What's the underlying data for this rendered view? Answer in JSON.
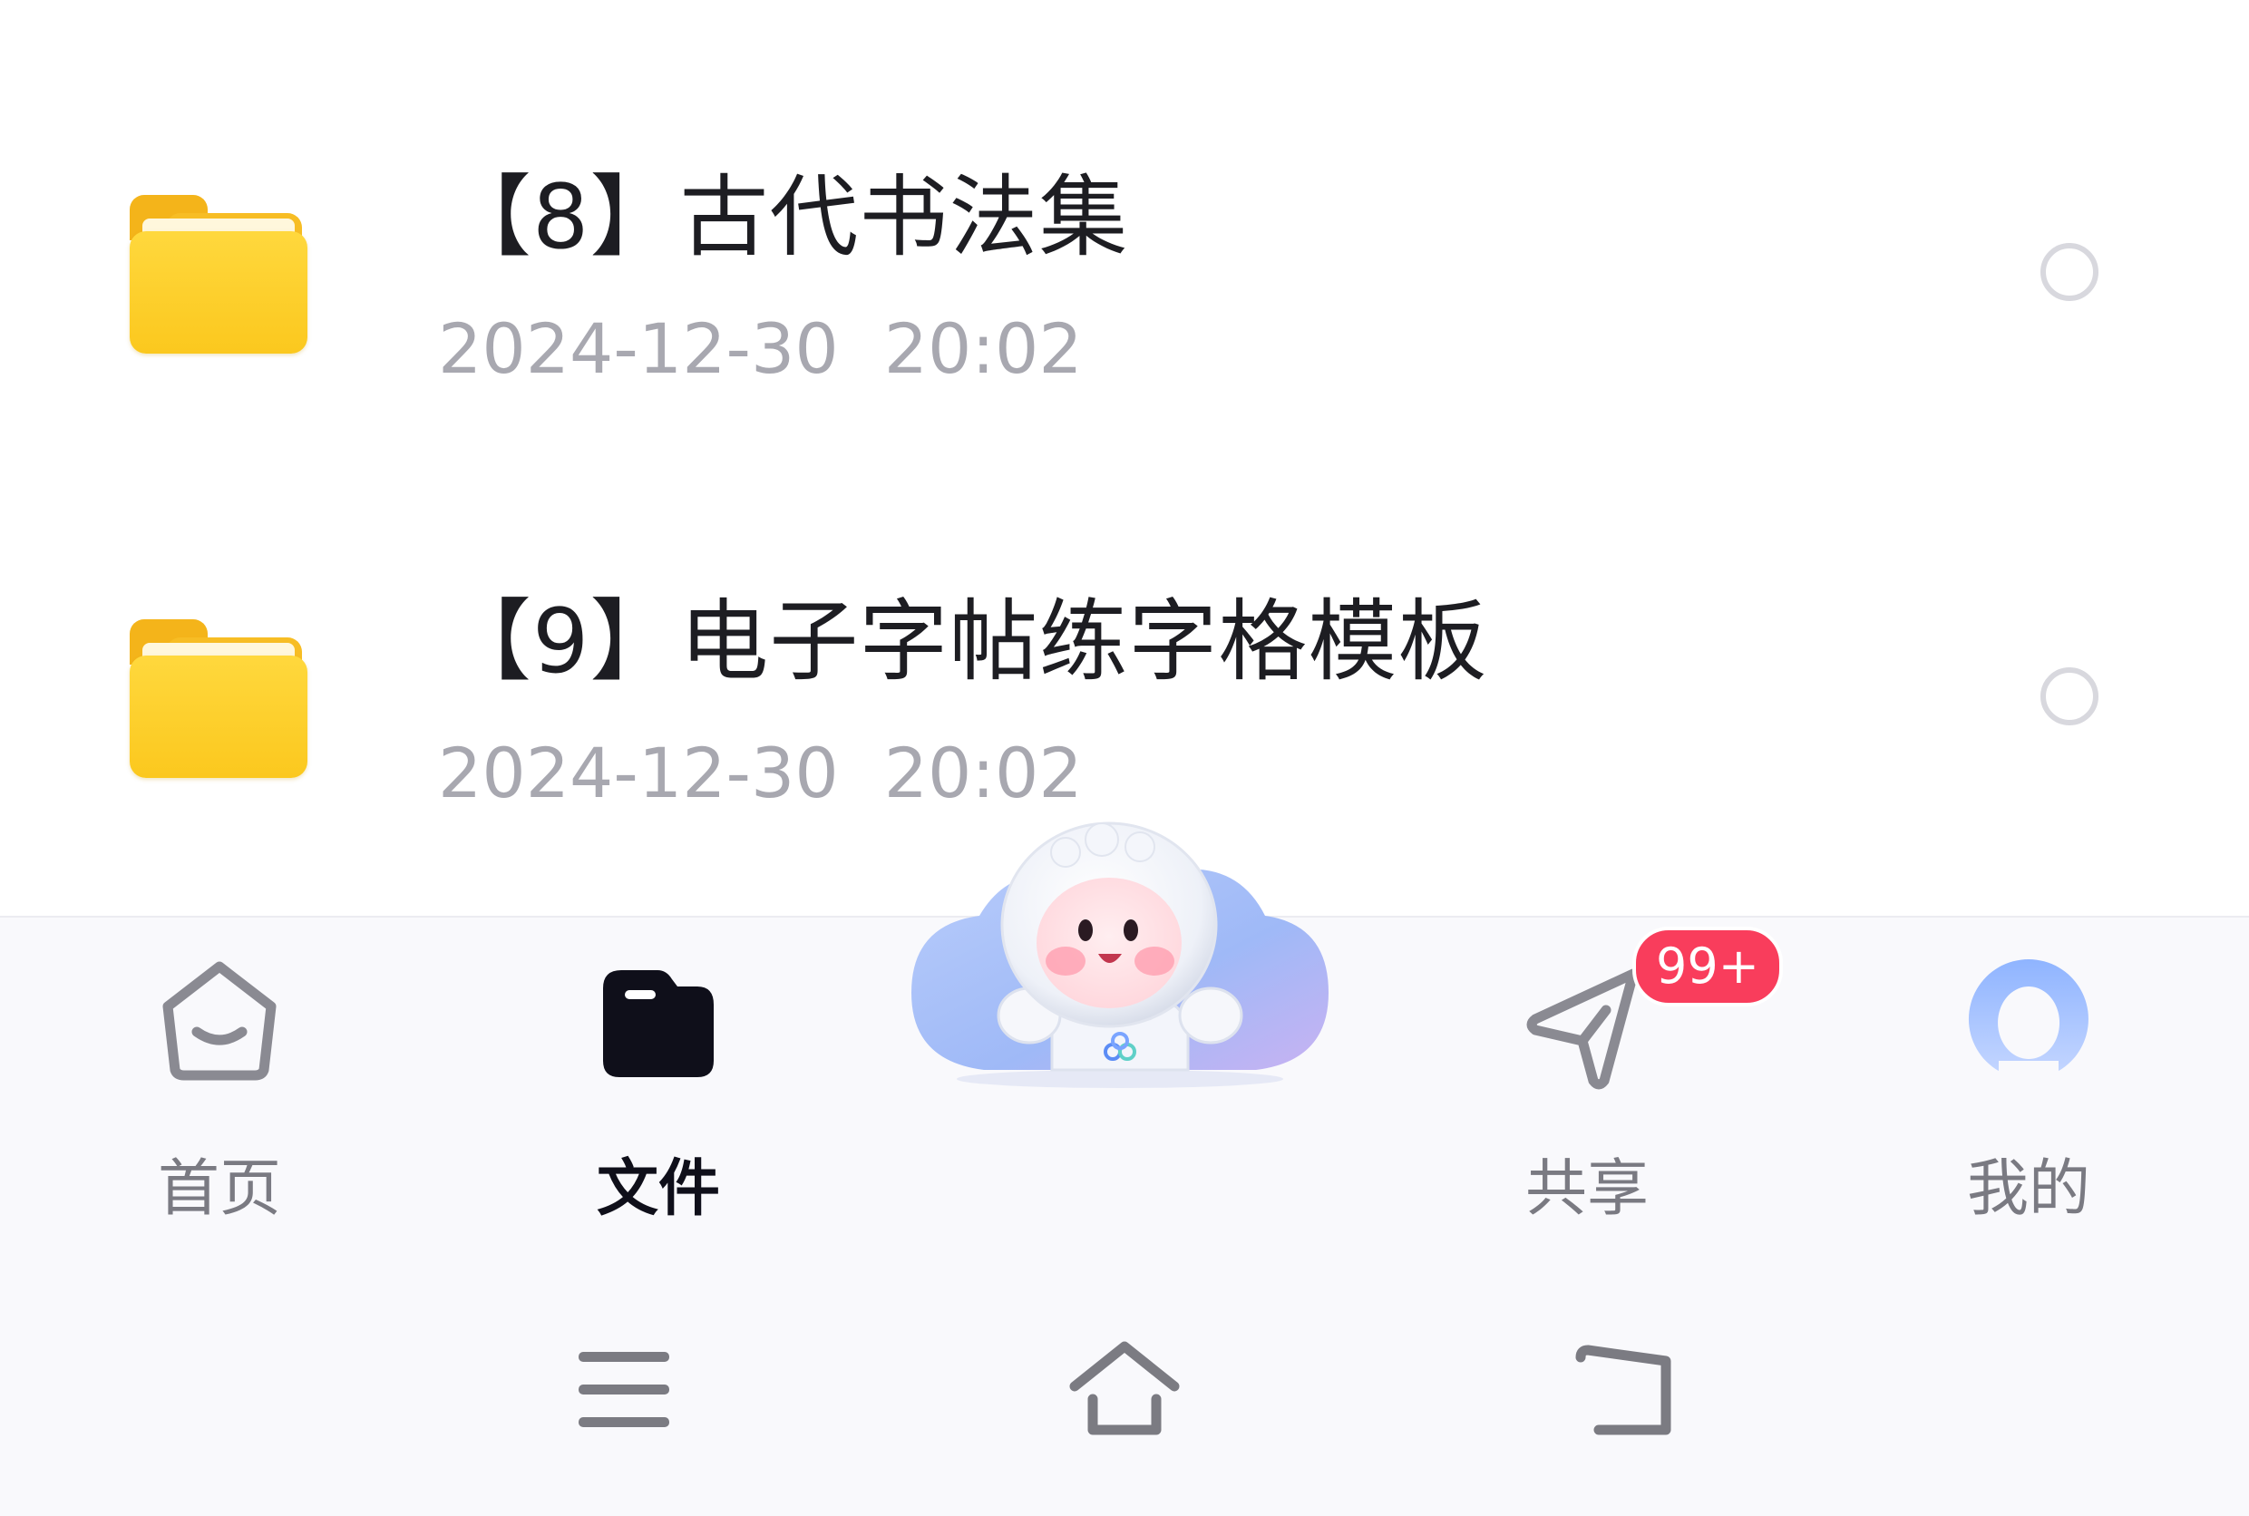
{
  "files": [
    {
      "icon": "folder-icon",
      "name": "【8】古代书法集",
      "date": "2024-12-30",
      "time": "20:02"
    },
    {
      "icon": "folder-icon",
      "name": "【9】电子字帖练字格模板",
      "date": "2024-12-30",
      "time": "20:02"
    }
  ],
  "tabbar": {
    "home": {
      "label": "首页",
      "icon": "home-icon"
    },
    "files": {
      "label": "文件",
      "icon": "folder-tab-icon",
      "active": true
    },
    "center": {
      "icon": "mascot-astronaut-icon"
    },
    "share": {
      "label": "共享",
      "icon": "paper-plane-icon",
      "badge": "99+"
    },
    "mine": {
      "label": "我的",
      "icon": "profile-icon"
    }
  },
  "system_nav": {
    "menu": "menu-icon",
    "home": "home-outline-icon",
    "back": "back-icon"
  },
  "colors": {
    "folder": "#FBC81E",
    "badge": "#F93D5C",
    "active_tab": "#0F0F1A",
    "inactive_tab": "#7A7A82",
    "meta_text": "#A8A8B0"
  }
}
